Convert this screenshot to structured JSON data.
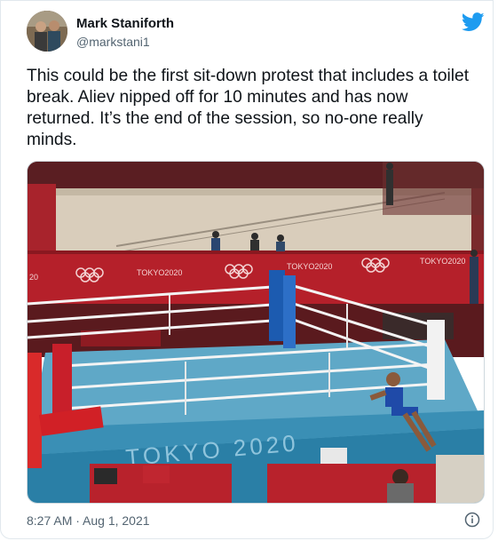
{
  "author": {
    "display_name": "Mark Staniforth",
    "handle": "@markstani1",
    "avatar_icon": "profile-photo"
  },
  "tweet": {
    "text": "This could be the first sit-down protest that includes a toilet break. Aliev nipped off for 10 minutes and has now returned. It’s the end of the session, so no-one really minds."
  },
  "media": {
    "description_icon": "boxing-ring-photo",
    "banner_texts": [
      "TOKYO2020",
      "TOKYO2020",
      "TOKYO2020",
      "20"
    ],
    "canvas_text": "TOKYO 2020"
  },
  "footer": {
    "timestamp": "8:27 AM · Aug 1, 2021",
    "info_icon": "info-icon"
  },
  "colors": {
    "twitter_blue": "#1d9bf0",
    "text_primary": "#0f1419",
    "text_secondary": "#536471",
    "ring_canvas": "#2a7fa6",
    "arena_red": "#b5202a"
  }
}
